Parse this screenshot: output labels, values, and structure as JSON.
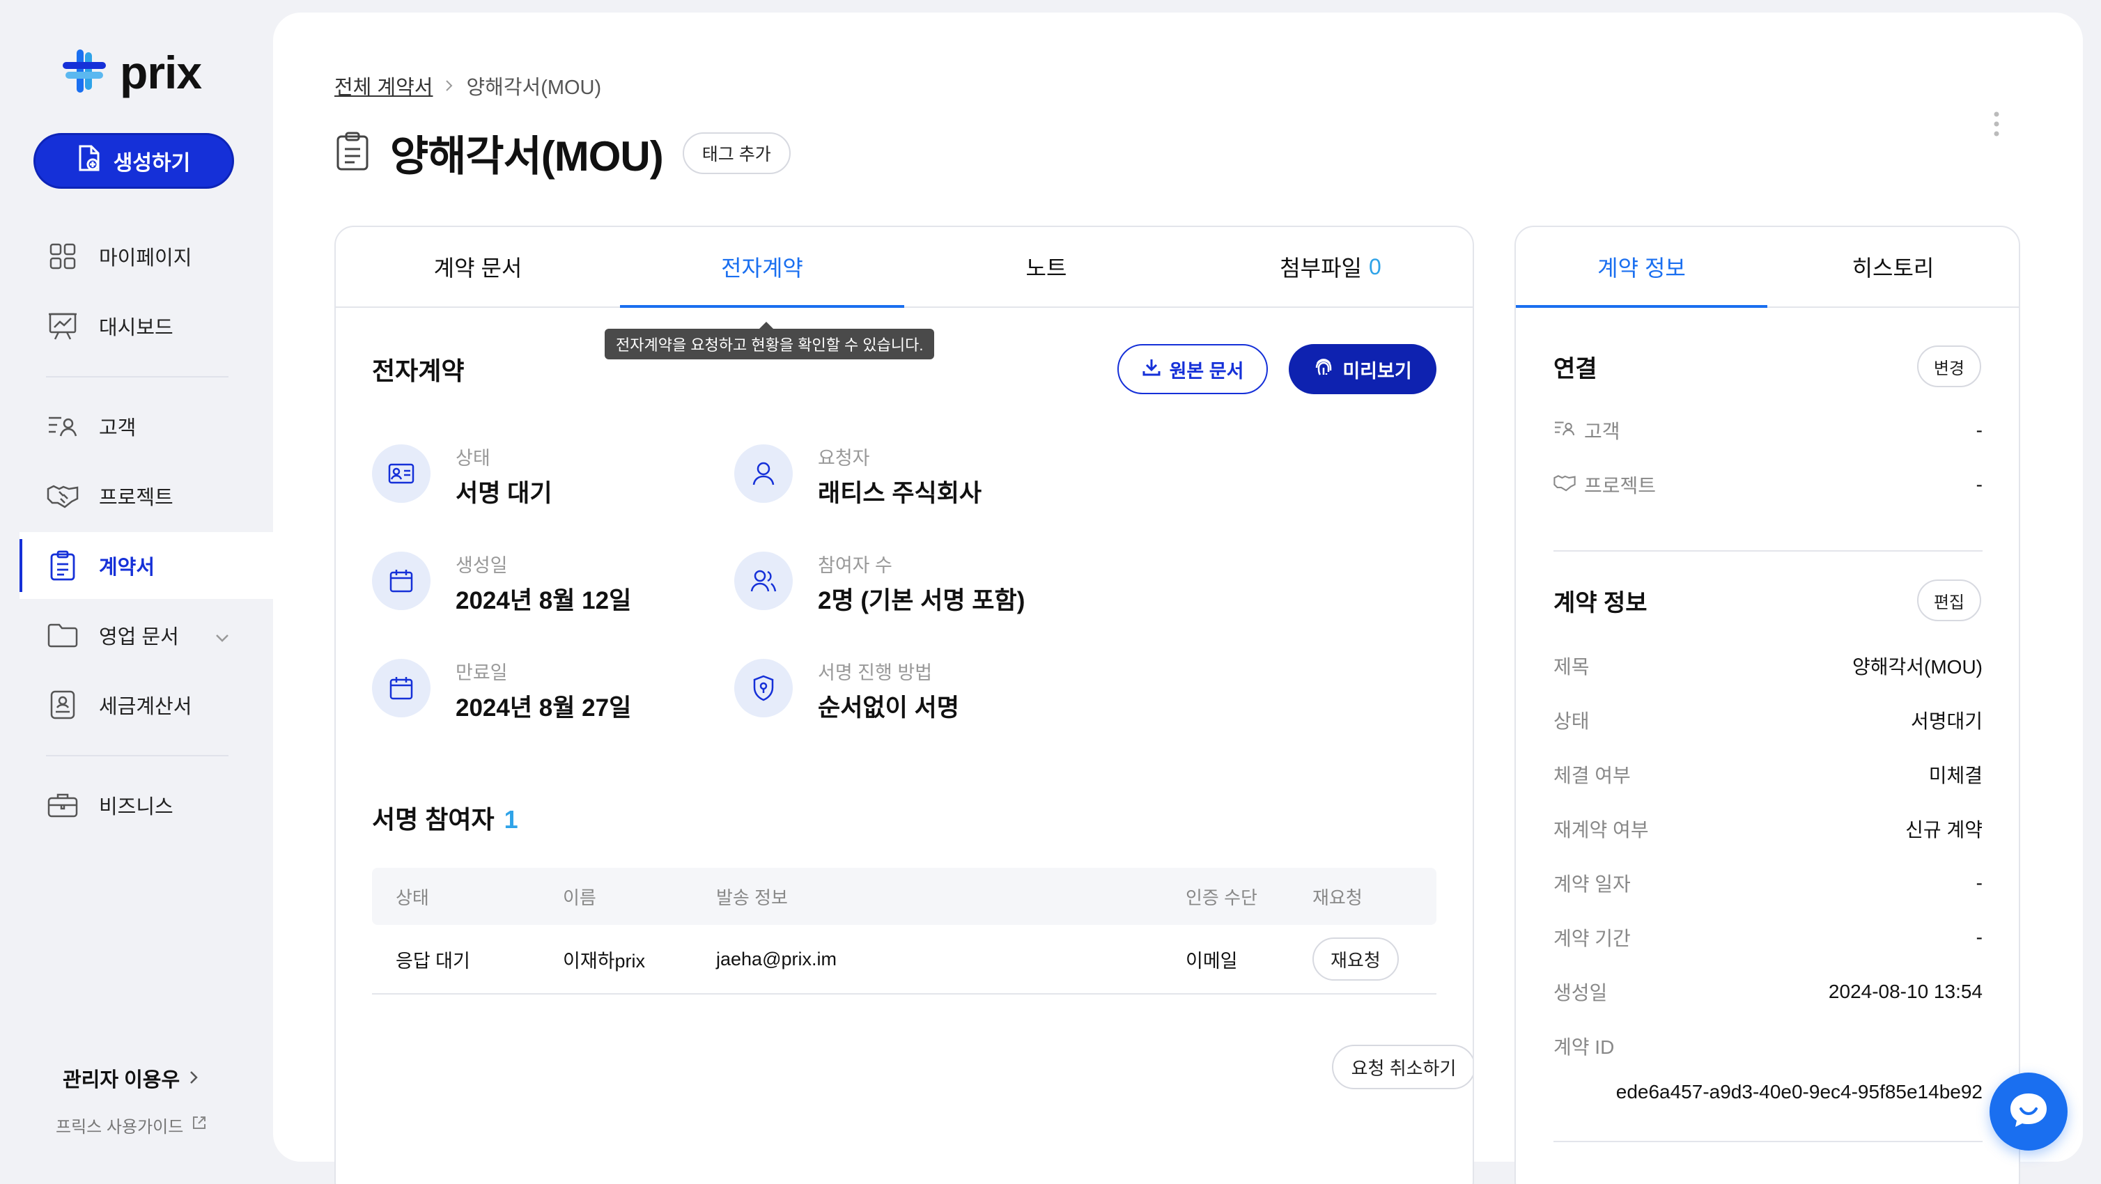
{
  "app": {
    "brand": "prix",
    "accent": "#1530d8",
    "link_blue": "#1a6ff0"
  },
  "sidebar": {
    "create_label": "생성하기",
    "items": [
      {
        "label": "마이페이지",
        "icon": "grid-icon"
      },
      {
        "label": "대시보드",
        "icon": "presentation-chart-icon"
      },
      {
        "label": "고객",
        "icon": "customer-list-icon"
      },
      {
        "label": "프로젝트",
        "icon": "handshake-icon"
      },
      {
        "label": "계약서",
        "icon": "clipboard-icon"
      },
      {
        "label": "영업 문서",
        "icon": "folder-icon"
      },
      {
        "label": "세금계산서",
        "icon": "receipt-icon"
      },
      {
        "label": "비즈니스",
        "icon": "briefcase-icon"
      }
    ],
    "admin_label": "관리자 이용우",
    "guide_label": "프릭스 사용가이드"
  },
  "breadcrumb": {
    "root": "전체 계약서",
    "current": "양해각서(MOU)"
  },
  "page": {
    "title": "양해각서(MOU)",
    "tag_button": "태그 추가"
  },
  "tabs": [
    {
      "label": "계약 문서"
    },
    {
      "label": "전자계약"
    },
    {
      "label": "노트"
    },
    {
      "label": "첨부파일",
      "count": "0"
    }
  ],
  "tooltip": "전자계약을 요청하고 현황을 확인할 수 있습니다.",
  "econtract": {
    "title": "전자계약",
    "original_button": "원본 문서",
    "preview_button": "미리보기",
    "info": {
      "status_label": "상태",
      "status_value": "서명 대기",
      "requester_label": "요청자",
      "requester_value": "래티스 주식회사",
      "created_label": "생성일",
      "created_value": "2024년 8월 12일",
      "participants_label": "참여자 수",
      "participants_value": "2명 (기본 서명 포함)",
      "expiry_label": "만료일",
      "expiry_value": "2024년 8월 27일",
      "method_label": "서명 진행 방법",
      "method_value": "순서없이 서명"
    },
    "signers_title": "서명 참여자",
    "signers_count": "1",
    "table": {
      "headers": [
        "상태",
        "이름",
        "발송 정보",
        "인증 수단",
        "재요청"
      ],
      "rows": [
        {
          "status": "응답 대기",
          "name": "이재하prix",
          "email": "jaeha@prix.im",
          "auth": "이메일",
          "action": "재요청"
        }
      ]
    },
    "cancel_button": "요청 취소하기"
  },
  "right_panel": {
    "tabs": [
      {
        "label": "계약 정보"
      },
      {
        "label": "히스토리"
      }
    ],
    "link_section": {
      "title": "연결",
      "button": "변경",
      "rows": [
        {
          "k": "고객",
          "v": "-"
        },
        {
          "k": "프로젝트",
          "v": "-"
        }
      ]
    },
    "info_section": {
      "title": "계약 정보",
      "button": "편집",
      "rows": [
        {
          "k": "제목",
          "v": "양해각서(MOU)"
        },
        {
          "k": "상태",
          "v": "서명대기"
        },
        {
          "k": "체결 여부",
          "v": "미체결"
        },
        {
          "k": "재계약 여부",
          "v": "신규 계약"
        },
        {
          "k": "계약 일자",
          "v": "-"
        },
        {
          "k": "계약 기간",
          "v": "-"
        },
        {
          "k": "생성일",
          "v": "2024-08-10 13:54"
        }
      ],
      "id_label": "계약 ID",
      "id_value": "ede6a457-a9d3-40e0-9ec4-95f85e14be92"
    }
  }
}
